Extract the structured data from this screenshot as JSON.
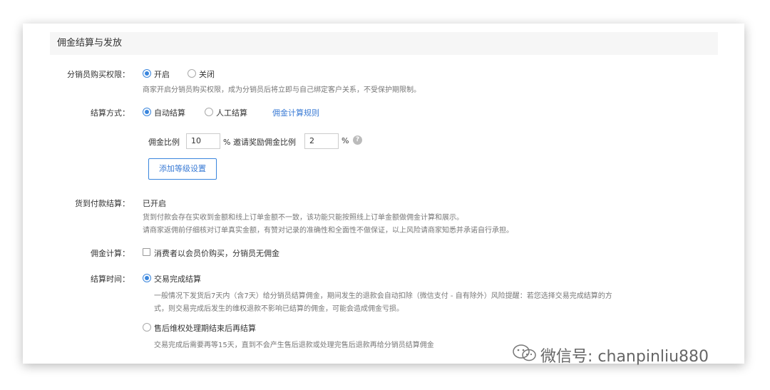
{
  "section": {
    "title": "佣金结算与发放"
  },
  "purchase_permission": {
    "label": "分销员购买权限：",
    "options": [
      {
        "label": "开启",
        "selected": true
      },
      {
        "label": "关闭",
        "selected": false
      }
    ],
    "hint": "商家开启分销员购买权限，成为分销员后将立即与自己绑定客户关系，不受保护期限制。"
  },
  "settlement_method": {
    "label": "结算方式：",
    "options": [
      {
        "label": "自动结算",
        "selected": true
      },
      {
        "label": "人工结算",
        "selected": false
      }
    ],
    "rules_link": "佣金计算规则",
    "commission_label": "佣金比例",
    "commission_value": "10",
    "percent": "%",
    "invite_label": "% 邀请奖励佣金比例",
    "invite_value": "2",
    "help_icon": "question-circle-icon",
    "add_level_button": "添加等级设置"
  },
  "cod_settlement": {
    "label": "货到付款结算：",
    "status": "已开启",
    "hint_1": "货到付款会存在实收到金额和线上订单金额不一致，该功能只能按照线上订单金额做佣金计算和展示。",
    "hint_2": "请商家返佣前仔细核对订单真实金额，有赞对记录的准确性和全面性不做保证，以上风险请商家知悉并承诺自行承担。"
  },
  "commission_calc": {
    "label": "佣金计算：",
    "checkbox_label": "消费者以会员价购买，分销员无佣金",
    "checked": false
  },
  "settlement_time": {
    "label": "结算时间：",
    "option_1": {
      "label": "交易完成结算",
      "selected": true
    },
    "option_1_hint_1": "一般情况下发货后7天内（含7天）给分销员结算佣金，期间发生的退款会自动扣除（微信支付 - 自有除外）风险提醒：若您选择交易完成结算的方",
    "option_1_hint_2": "式，则交易完成后发生的维权退款不影响已结算的佣金，可能会造成佣金亏损。",
    "option_2": {
      "label": "售后维权处理期结束后再结算",
      "selected": false
    },
    "option_2_hint": "交易完成后需要再等15天，直到不会产生售后退款或处理完售后退款再给分销员结算佣金"
  },
  "watermark": {
    "text": "微信号: chanpinliu880",
    "icon": "wechat-icon"
  },
  "colors": {
    "accent": "#3a86dd",
    "link": "#3a7bd5",
    "header_bg": "#f6f6f6"
  }
}
